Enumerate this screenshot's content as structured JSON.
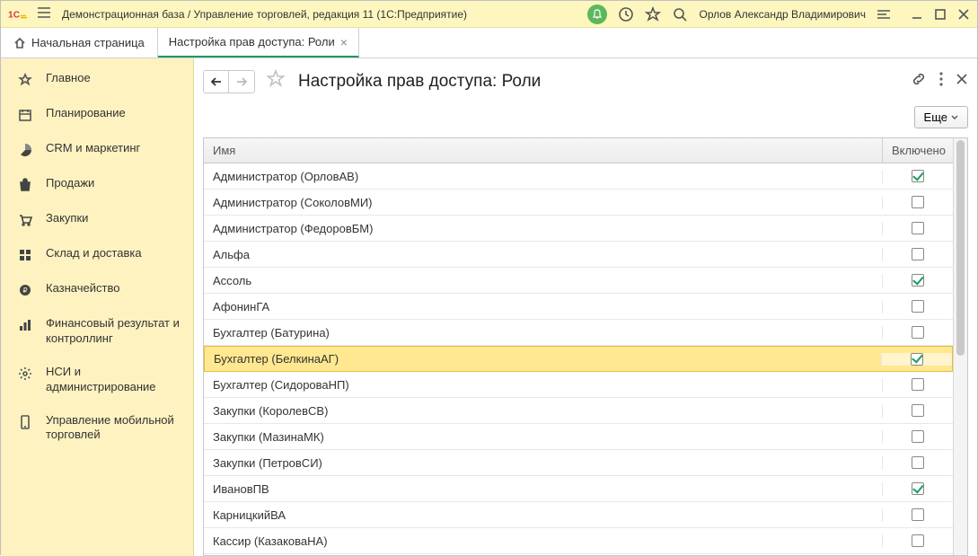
{
  "titlebar": {
    "title": "Демонстрационная база / Управление торговлей, редакция 11  (1С:Предприятие)",
    "user": "Орлов Александр Владимирович"
  },
  "tabs": {
    "home": "Начальная страница",
    "active": "Настройка прав доступа: Роли"
  },
  "sidebar": {
    "items": [
      {
        "label": "Главное",
        "icon": "star"
      },
      {
        "label": "Планирование",
        "icon": "plan"
      },
      {
        "label": "CRM и маркетинг",
        "icon": "pie"
      },
      {
        "label": "Продажи",
        "icon": "bag"
      },
      {
        "label": "Закупки",
        "icon": "cart"
      },
      {
        "label": "Склад и доставка",
        "icon": "grid"
      },
      {
        "label": "Казначейство",
        "icon": "coin"
      },
      {
        "label": "Финансовый результат и контроллинг",
        "icon": "bars"
      },
      {
        "label": "НСИ и администрирование",
        "icon": "gear"
      },
      {
        "label": "Управление мобильной торговлей",
        "icon": "phone"
      }
    ]
  },
  "page": {
    "title": "Настройка прав доступа: Роли",
    "more": "Еще"
  },
  "table": {
    "columns": {
      "name": "Имя",
      "enabled": "Включено"
    },
    "rows": [
      {
        "name": "Администратор (ОрловАВ)",
        "enabled": true
      },
      {
        "name": "Администратор (СоколовМИ)",
        "enabled": false
      },
      {
        "name": "Администратор (ФедоровБМ)",
        "enabled": false
      },
      {
        "name": "Альфа",
        "enabled": false
      },
      {
        "name": "Ассоль",
        "enabled": true
      },
      {
        "name": "АфонинГА",
        "enabled": false
      },
      {
        "name": "Бухгалтер (Батурина)",
        "enabled": false
      },
      {
        "name": "Бухгалтер (БелкинаАГ)",
        "enabled": true,
        "selected": true
      },
      {
        "name": "Бухгалтер (СидороваНП)",
        "enabled": false
      },
      {
        "name": "Закупки (КоролевСВ)",
        "enabled": false
      },
      {
        "name": "Закупки (МазинаМК)",
        "enabled": false
      },
      {
        "name": "Закупки (ПетровСИ)",
        "enabled": false
      },
      {
        "name": "ИвановПВ",
        "enabled": true
      },
      {
        "name": "КарницкийВА",
        "enabled": false
      },
      {
        "name": "Кассир (КазаковаНА)",
        "enabled": false
      }
    ]
  }
}
